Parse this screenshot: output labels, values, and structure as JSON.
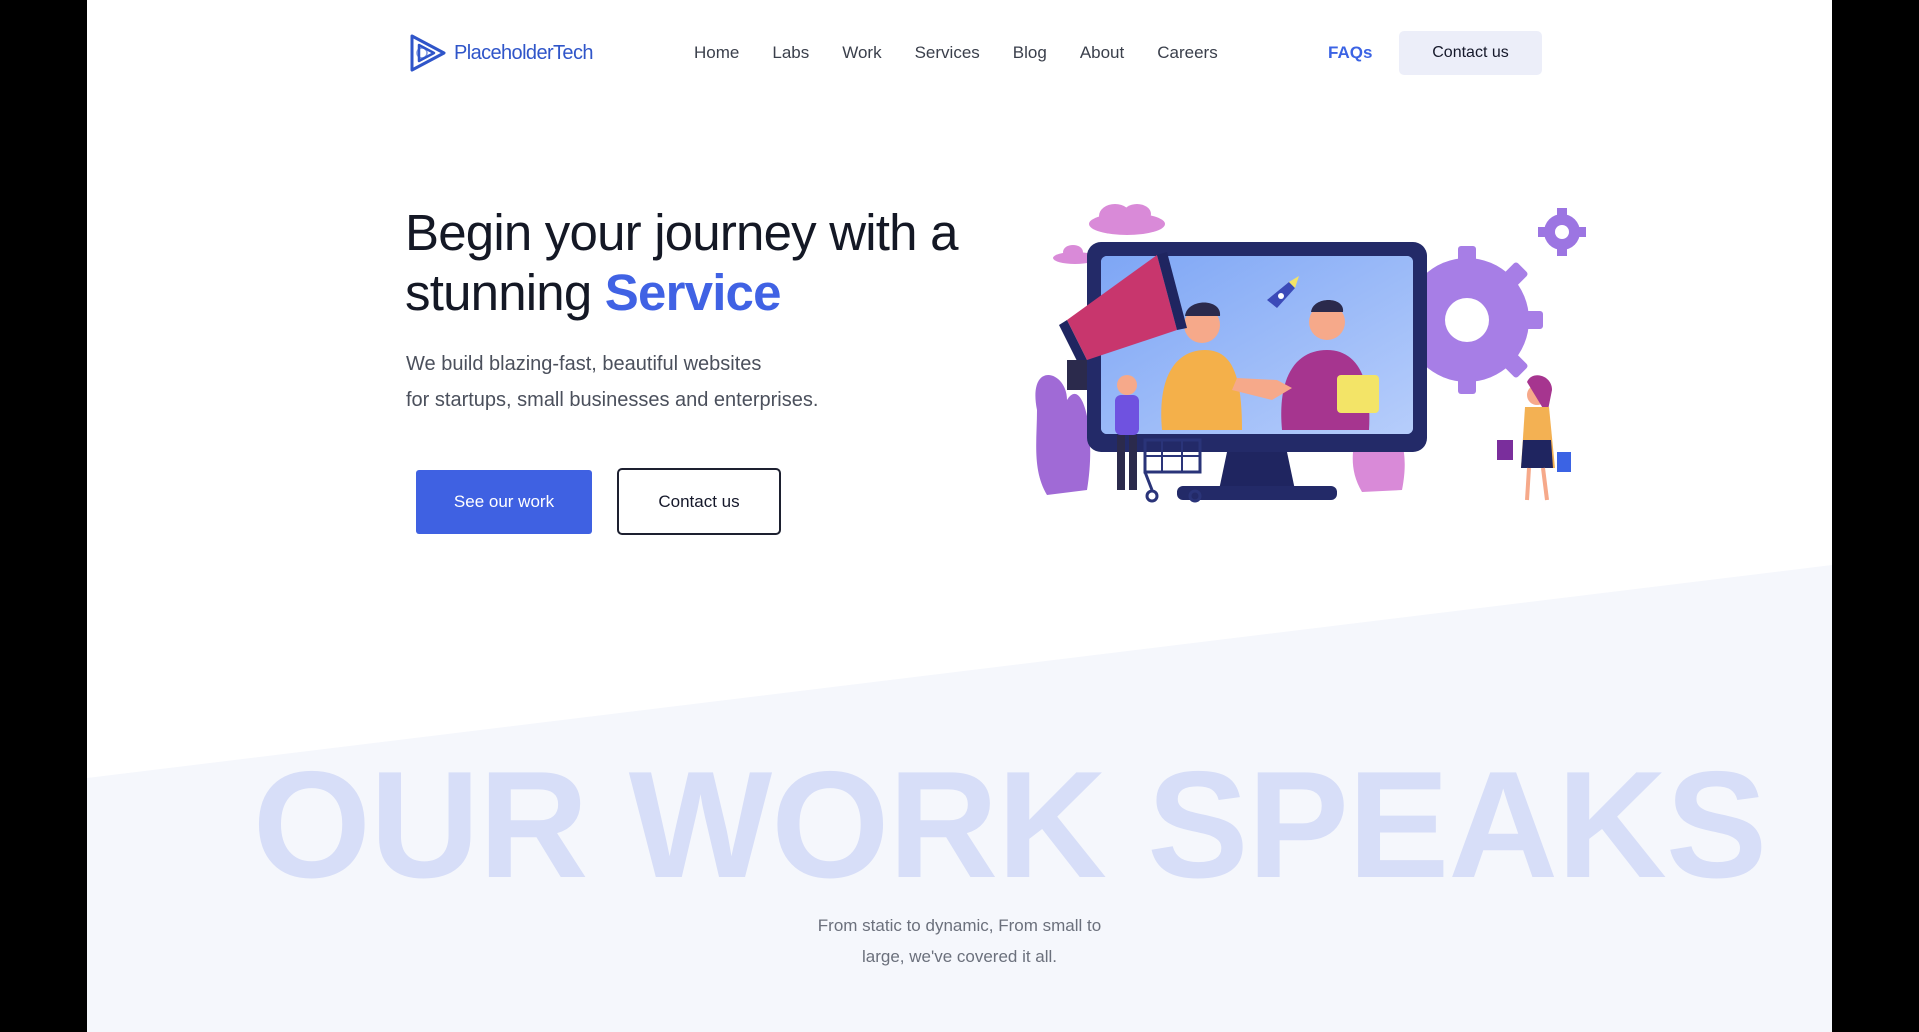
{
  "brand": {
    "name": "PlaceholderTech",
    "accent": "#4062e4"
  },
  "nav": {
    "items": [
      "Home",
      "Labs",
      "Work",
      "Services",
      "Blog",
      "About",
      "Careers"
    ],
    "faqs_label": "FAQs",
    "contact_label": "Contact us"
  },
  "hero": {
    "title_line1": "Begin your journey with a",
    "title_line2_prefix": "stunning ",
    "title_highlight": "Service",
    "subtitle_line1": "We build blazing-fast, beautiful websites",
    "subtitle_line2": "for startups, small businesses and enterprises.",
    "primary_button": "See our work",
    "secondary_button": "Contact us",
    "illustration_icon": "business-handshake-illustration"
  },
  "work_section": {
    "heading": "OUR WORK SPEAKS",
    "subtitle_line1": "From static to dynamic, From small to",
    "subtitle_line2": "large, we've covered it all."
  },
  "colors": {
    "primary": "#3f61e2",
    "heading_watermark": "#d7def8",
    "section_bg": "#f5f7fc"
  }
}
